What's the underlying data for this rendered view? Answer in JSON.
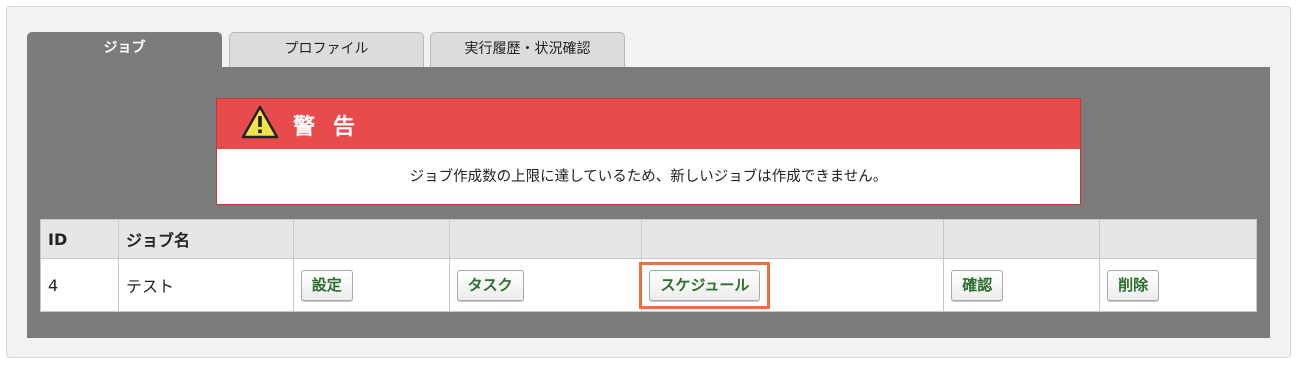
{
  "tabs": [
    {
      "label": "ジョブ",
      "active": true
    },
    {
      "label": "プロファイル",
      "active": false
    },
    {
      "label": "実行履歴・状況確認",
      "active": false
    }
  ],
  "warning": {
    "icon": "warning-triangle-icon",
    "title": "警告",
    "message": "ジョブ作成数の上限に達しているため、新しいジョブは作成できません。",
    "colors": {
      "header": "#e84b4b",
      "border": "#c9373b"
    }
  },
  "table": {
    "headers": [
      "ID",
      "ジョブ名",
      "",
      "",
      "",
      "",
      ""
    ],
    "rows": [
      {
        "id": "4",
        "name": "テスト",
        "buttons": {
          "settings": "設定",
          "task": "タスク",
          "schedule": "スケジュール",
          "confirm": "確認",
          "delete": "削除"
        }
      }
    ]
  },
  "colors": {
    "button_text": "#2c6e2c",
    "highlight": "#e8713c",
    "panel": "#7b7b7b"
  }
}
